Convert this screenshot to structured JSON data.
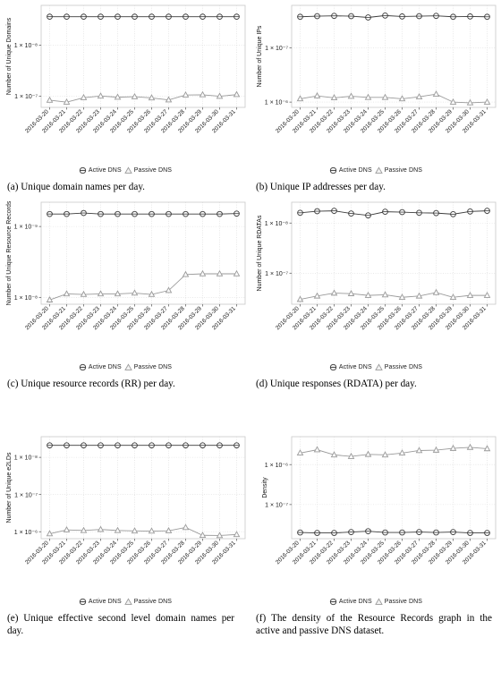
{
  "figure": {
    "legend": {
      "active_label": "Active DNS",
      "passive_label": "Passive DNS",
      "active_marker": "circle-marker-icon",
      "passive_marker": "triangle-marker-icon",
      "active_color": "#3c3c3c",
      "passive_color": "#9a9a9a"
    },
    "captions": {
      "a": "(a)  Unique domain names per day.",
      "b": "(b) Unique IP addresses per day.",
      "c": "(c) Unique resource records (RR) per day.",
      "d": "(d) Unique responses (RDATA) per day.",
      "e": "(e) Unique effective second level domain names per day.",
      "f": "(f) The density of the Resource Records graph in the active and passive DNS dataset."
    }
  },
  "chart_data": [
    {
      "panel": "a",
      "type": "line",
      "title": "",
      "xlabel": "",
      "ylabel": "Number of Unique Domains",
      "yscale": "log",
      "ytick_labels": [
        "1 × 10⁻⁸",
        "1 × 10⁻⁷"
      ],
      "ytick_values": [
        100000000.0,
        10000000.0
      ],
      "ylim": [
        6000000.0,
        600000000.0
      ],
      "grid": true,
      "legend_position": "bottom",
      "categories": [
        "2016-03-20",
        "2016-03-21",
        "2016-03-22",
        "2016-03-23",
        "2016-03-24",
        "2016-03-25",
        "2016-03-26",
        "2016-03-27",
        "2016-03-28",
        "2016-03-29",
        "2016-03-30",
        "2016-03-31"
      ],
      "series": [
        {
          "name": "Active DNS",
          "values": [
            360000000.0,
            360000000.0,
            360000000.0,
            360000000.0,
            360000000.0,
            360000000.0,
            360000000.0,
            360000000.0,
            360000000.0,
            360000000.0,
            360000000.0,
            360000000.0
          ]
        },
        {
          "name": "Passive DNS",
          "values": [
            8300000.0,
            7600000.0,
            9300000.0,
            10000000.0,
            9500000.0,
            9700000.0,
            9200000.0,
            8400000.0,
            10500000.0,
            10600000.0,
            9900000.0,
            10700000.0
          ]
        }
      ]
    },
    {
      "panel": "b",
      "type": "line",
      "title": "",
      "xlabel": "",
      "ylabel": "Number of Unique IPs",
      "yscale": "log",
      "ytick_labels": [
        "1 × 10⁻⁷",
        "1 × 10⁻⁶"
      ],
      "ytick_values": [
        10000000.0,
        1000000.0
      ],
      "ylim": [
        800000.0,
        60000000.0
      ],
      "grid": true,
      "legend_position": "bottom",
      "categories": [
        "2016-03-20",
        "2016-03-21",
        "2016-03-22",
        "2016-03-23",
        "2016-03-24",
        "2016-03-25",
        "2016-03-26",
        "2016-03-27",
        "2016-03-28",
        "2016-03-29",
        "2016-03-30",
        "2016-03-31"
      ],
      "series": [
        {
          "name": "Active DNS",
          "values": [
            37000000.0,
            38000000.0,
            38500000.0,
            38000000.0,
            36000000.0,
            39000000.0,
            37500000.0,
            38000000.0,
            38500000.0,
            37000000.0,
            37500000.0,
            37000000.0
          ]
        },
        {
          "name": "Passive DNS",
          "values": [
            1150000.0,
            1300000.0,
            1200000.0,
            1280000.0,
            1220000.0,
            1220000.0,
            1150000.0,
            1250000.0,
            1400000.0,
            1000000.0,
            970000.0,
            1000000.0
          ]
        }
      ]
    },
    {
      "panel": "c",
      "type": "line",
      "title": "",
      "xlabel": "",
      "ylabel": "Number of Unique Resource Records",
      "yscale": "log",
      "ytick_labels": [
        "1 × 10⁻⁹",
        "1 × 10⁻⁸"
      ],
      "ytick_values": [
        1000000000.0,
        100000000.0
      ],
      "ylim": [
        80000000.0,
        2200000000.0
      ],
      "grid": true,
      "legend_position": "bottom",
      "categories": [
        "2016-03-20",
        "2016-03-21",
        "2016-03-22",
        "2016-03-23",
        "2016-03-24",
        "2016-03-25",
        "2016-03-26",
        "2016-03-27",
        "2016-03-28",
        "2016-03-29",
        "2016-03-30",
        "2016-03-31"
      ],
      "series": [
        {
          "name": "Active DNS",
          "values": [
            1500000000.0,
            1500000000.0,
            1550000000.0,
            1500000000.0,
            1500000000.0,
            1500000000.0,
            1500000000.0,
            1500000000.0,
            1500000000.0,
            1500000000.0,
            1500000000.0,
            1520000000.0
          ]
        },
        {
          "name": "Passive DNS",
          "values": [
            92000000.0,
            112000000.0,
            110000000.0,
            112000000.0,
            112000000.0,
            115000000.0,
            110000000.0,
            125000000.0,
            210000000.0,
            215000000.0,
            215000000.0,
            215000000.0
          ]
        }
      ]
    },
    {
      "panel": "d",
      "type": "line",
      "title": "",
      "xlabel": "",
      "ylabel": "Number of Unique RDATAs",
      "yscale": "log",
      "ytick_labels": [
        "1 × 10⁻⁸",
        "1 × 10⁻⁷"
      ],
      "ytick_values": [
        100000000.0,
        10000000.0
      ],
      "ylim": [
        2400000.0,
        260000000.0
      ],
      "grid": true,
      "legend_position": "bottom",
      "categories": [
        "2016-03-20",
        "2016-03-21",
        "2016-03-22",
        "2016-03-23",
        "2016-03-24",
        "2016-03-25",
        "2016-03-26",
        "2016-03-27",
        "2016-03-28",
        "2016-03-29",
        "2016-03-30",
        "2016-03-31"
      ],
      "series": [
        {
          "name": "Active DNS",
          "values": [
            160000000.0,
            172000000.0,
            175000000.0,
            155000000.0,
            142000000.0,
            168000000.0,
            165000000.0,
            160000000.0,
            158000000.0,
            150000000.0,
            170000000.0,
            175000000.0
          ]
        },
        {
          "name": "Passive DNS",
          "values": [
            3000000.0,
            3500000.0,
            4000000.0,
            3900000.0,
            3600000.0,
            3700000.0,
            3300000.0,
            3500000.0,
            4100000.0,
            3300000.0,
            3600000.0,
            3600000.0
          ]
        }
      ]
    },
    {
      "panel": "e",
      "type": "line",
      "title": "",
      "xlabel": "",
      "ylabel": "Number of Unique e2LDs",
      "yscale": "log",
      "ytick_labels": [
        "1 × 10⁻⁸",
        "1 × 10⁻⁷",
        "1 × 10⁻⁶"
      ],
      "ytick_values": [
        100000000.0,
        10000000.0,
        1000000.0
      ],
      "ylim": [
        650000.0,
        360000000.0
      ],
      "grid": true,
      "legend_position": "bottom",
      "categories": [
        "2016-03-20",
        "2016-03-21",
        "2016-03-22",
        "2016-03-23",
        "2016-03-24",
        "2016-03-25",
        "2016-03-26",
        "2016-03-27",
        "2016-03-28",
        "2016-03-29",
        "2016-03-30",
        "2016-03-31"
      ],
      "series": [
        {
          "name": "Active DNS",
          "values": [
            210000000.0,
            210000000.0,
            210000000.0,
            210000000.0,
            210000000.0,
            210000000.0,
            210000000.0,
            210000000.0,
            210000000.0,
            210000000.0,
            210000000.0,
            210000000.0
          ]
        },
        {
          "name": "Passive DNS",
          "values": [
            880000.0,
            1120000.0,
            1080000.0,
            1150000.0,
            1080000.0,
            1050000.0,
            1040000.0,
            1060000.0,
            1300000.0,
            800000.0,
            790000.0,
            840000.0
          ]
        }
      ]
    },
    {
      "panel": "f",
      "type": "line",
      "title": "",
      "xlabel": "",
      "ylabel": "Density",
      "yscale": "log",
      "ytick_labels": [
        "1 × 10⁻⁶",
        "1 × 10⁻⁷"
      ],
      "ytick_values": [
        1e-06,
        1e-07
      ],
      "ylim": [
        1.4e-08,
        5e-06
      ],
      "grid": true,
      "legend_position": "bottom",
      "categories": [
        "2016-03-20",
        "2016-03-21",
        "2016-03-22",
        "2016-03-23",
        "2016-03-24",
        "2016-03-25",
        "2016-03-26",
        "2016-03-27",
        "2016-03-28",
        "2016-03-29",
        "2016-03-30",
        "2016-03-31"
      ],
      "series": [
        {
          "name": "Active DNS",
          "values": [
            2e-08,
            1.95e-08,
            1.95e-08,
            2.05e-08,
            2.15e-08,
            2e-08,
            2e-08,
            2.05e-08,
            2e-08,
            2.05e-08,
            1.95e-08,
            1.95e-08
          ]
        },
        {
          "name": "Passive DNS",
          "values": [
            1.95e-06,
            2.35e-06,
            1.75e-06,
            1.6e-06,
            1.8e-06,
            1.75e-06,
            1.95e-06,
            2.25e-06,
            2.3e-06,
            2.55e-06,
            2.7e-06,
            2.5e-06
          ]
        }
      ]
    }
  ]
}
